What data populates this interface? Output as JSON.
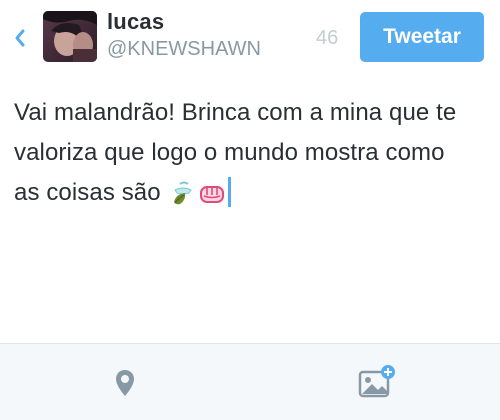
{
  "header": {
    "back_icon": "chevron-left-icon",
    "username": "lucas",
    "handle": "@KNEWSHAWN",
    "char_count": "46",
    "tweet_button_label": "Tweetar"
  },
  "compose": {
    "lines": [
      "Vai malandrão! Brinca com a mina que te",
      "valoriza que logo o mundo mostra como",
      "as coisas são"
    ],
    "emojis": [
      "tea-leaf-icon",
      "fist-icon"
    ]
  },
  "toolbar": {
    "location_icon": "location-pin-icon",
    "photo_icon": "add-photo-icon"
  },
  "colors": {
    "accent": "#55acee",
    "text": "#292f33",
    "muted": "#8899a6",
    "toolbar_icon": "#8899a6",
    "toolbar_bg": "#f5f8fa"
  }
}
